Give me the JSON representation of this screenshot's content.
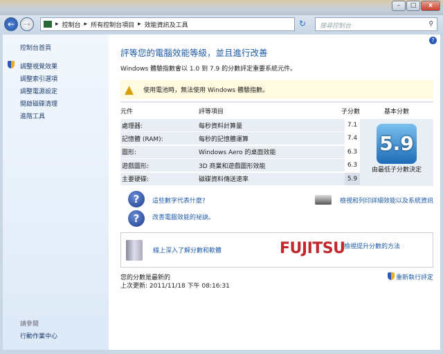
{
  "window": {
    "minimize": "–",
    "maximize": "□",
    "close": "x"
  },
  "nav": {
    "back": "←",
    "forward": "→",
    "breadcrumb": [
      "控制台",
      "所有控制台項目",
      "效能資訊及工具"
    ],
    "refresh": "↻",
    "search_placeholder": "搜尋控制台"
  },
  "sidebar": {
    "home": "控制台首頁",
    "items": [
      "調整視覺效果",
      "調整索引選項",
      "調整電源設定",
      "開啟磁碟清理",
      "進階工具"
    ],
    "see_also": "請參閱",
    "action_center": "行動作業中心"
  },
  "main": {
    "title": "評等您的電腦效能等級，並且進行改善",
    "subtitle": "Windows 體驗指數會以 1.0 到 7.9 的分數評定重要系統元件。",
    "warning": "使用電池時，無法使用 Windows 體驗指數。",
    "headers": {
      "component": "元件",
      "rated": "評等項目",
      "subscore": "子分數",
      "base": "基本分數"
    },
    "rows": [
      {
        "component": "處理器:",
        "desc": "每秒資料計算量",
        "score": "7.1"
      },
      {
        "component": "記憶體 (RAM):",
        "desc": "每秒的記憶體運算",
        "score": "7.4"
      },
      {
        "component": "圖形:",
        "desc": "Windows Aero 的桌面效能",
        "score": "6.3"
      },
      {
        "component": "遊戲圖形:",
        "desc": "3D 商業和遊戲圖形效能",
        "score": "6.3"
      },
      {
        "component": "主要硬碟:",
        "desc": "磁碟資料傳送速率",
        "score": "5.9"
      }
    ],
    "base_score": "5.9",
    "base_caption": "由最低子分數決定",
    "help1": "這些數字代表什麼?",
    "help2": "改善電腦效能的祕訣。",
    "print_link": "檢視和列印詳細效能以及系統資訊",
    "online_link": "線上深入了解分數和軟體",
    "brand": "FUJITSU",
    "improve_link": "檢視提升分數的方法",
    "status": "您的分數是最新的",
    "last_update": "上次更新: 2011/11/18 下午 08:16:31",
    "rerun": "重新執行評定"
  },
  "colors": {
    "accent": "#1e5aa8",
    "brand": "#c0282d",
    "warning_bg": "#fffbe0"
  }
}
